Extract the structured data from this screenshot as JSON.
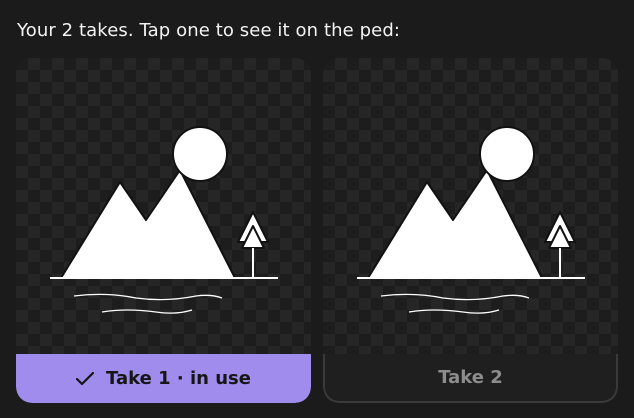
{
  "prompt": {
    "text": "Your 2 takes. Tap one to see it on the ped:"
  },
  "takes": [
    {
      "label": "Take 1 · in use",
      "selected": true,
      "icon": "check-icon",
      "thumbnail_icon": "mountain-landscape-icon"
    },
    {
      "label": "Take 2",
      "selected": false,
      "thumbnail_icon": "mountain-landscape-icon"
    }
  ],
  "colors": {
    "background": "#1b1b1b",
    "selected_accent": "#a08cec",
    "unselected_text": "#8d8d8d"
  }
}
